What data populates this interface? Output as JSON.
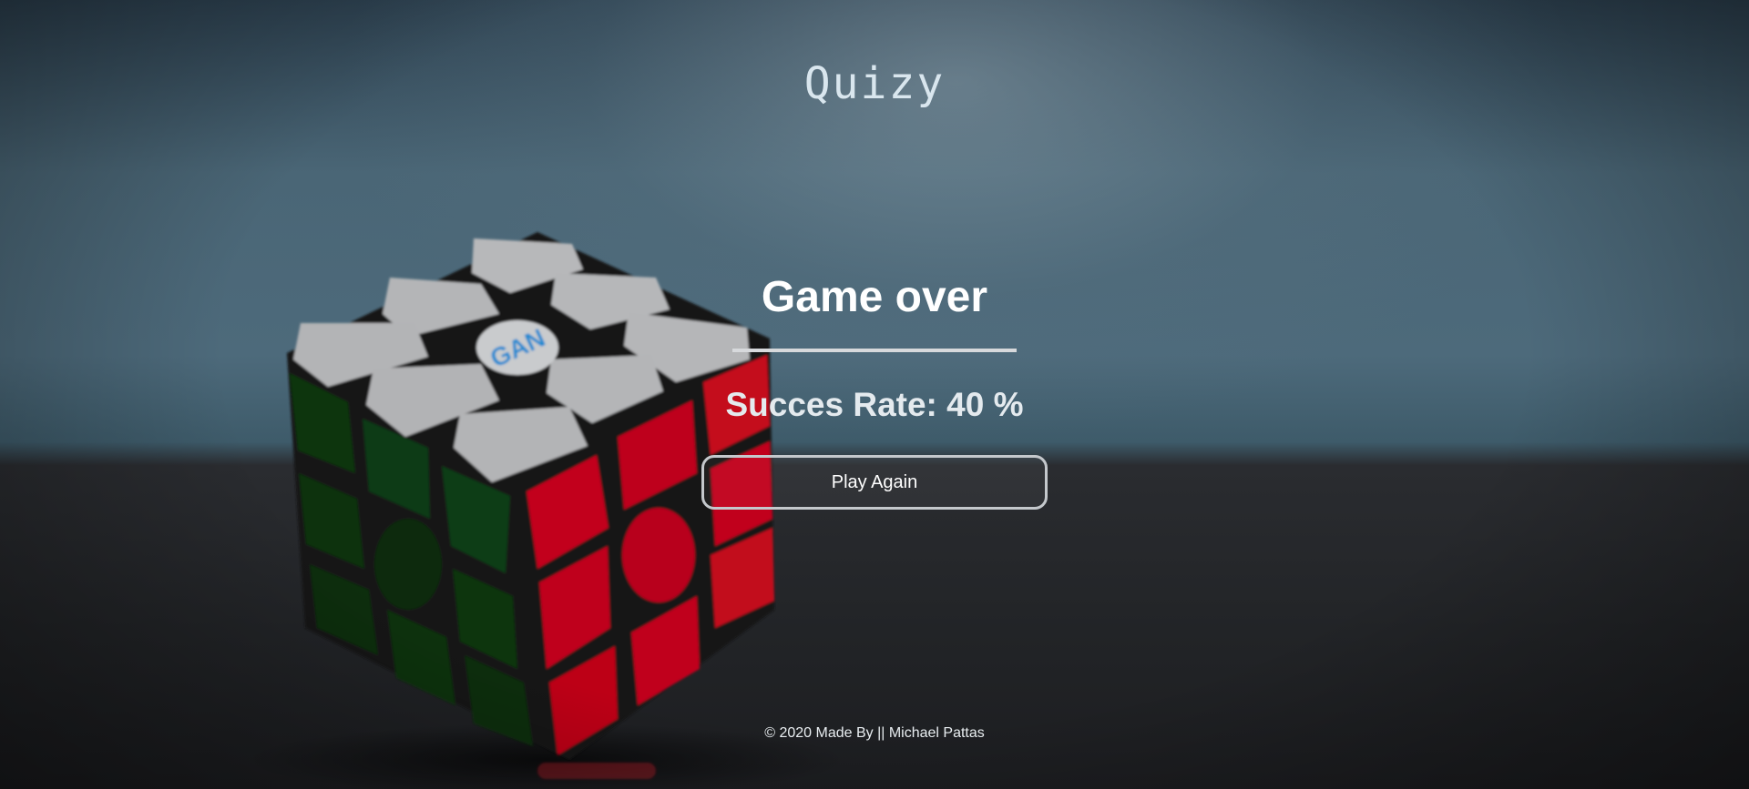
{
  "brand": {
    "name": "Quizy"
  },
  "result": {
    "title": "Game over",
    "success_rate_label": "Succes Rate: 40 %"
  },
  "actions": {
    "play_again_label": "Play Again"
  },
  "footer": {
    "text": "© 2020 Made By || Michael Pattas"
  },
  "background": {
    "description_icon": "rubiks-cube-photo",
    "cube_logo_text": "GAN"
  }
}
